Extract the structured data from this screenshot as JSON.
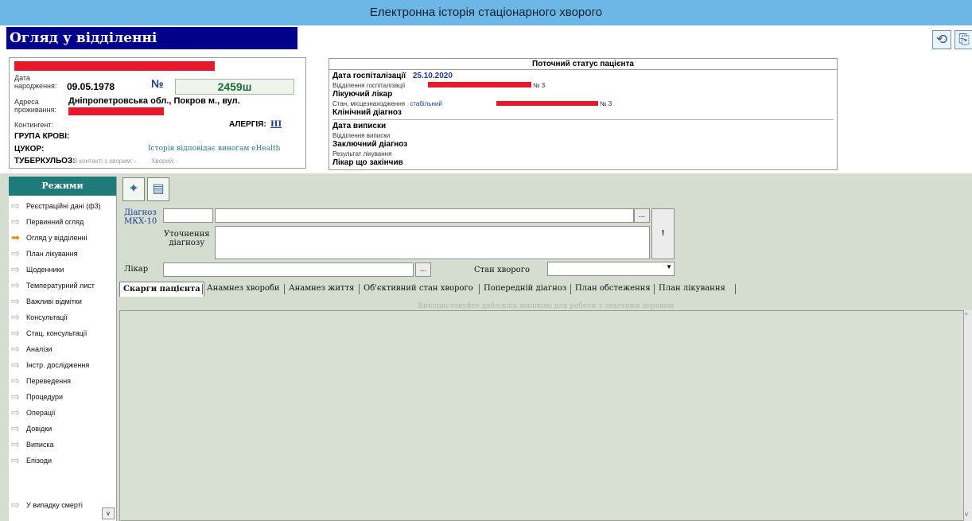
{
  "window": {
    "title": "Електронна історія стаціонарного хворого"
  },
  "screen": {
    "title": "Огляд у відділенні"
  },
  "top_icons": [
    {
      "icon": "refresh-icon",
      "glyph": "⟲"
    },
    {
      "icon": "exit-icon",
      "glyph": "⎘"
    }
  ],
  "patient": {
    "birth_label": "Дата\nнародження:",
    "birth_date": "09.05.1978",
    "number_label": "№",
    "number": "2459ш",
    "address_label": "Адреса\nпроживання:",
    "address": "Дніпропетровська обл., Покров м., вул.",
    "contingent_label": "Контингент:",
    "allergy_label": "АЛЕРГІЯ:",
    "allergy_value": "НІ",
    "blood_group_label": "ГРУПА КРОВІ:",
    "sugar_label": "ЦУКОР:",
    "ehealth_link": "Історія відповідає виногам eHealth",
    "tb_label": "ТУБЕРКУЛЬОЗ:",
    "tb_contact": "В контакті з хворим: -",
    "tb_sick": "Хворий: -"
  },
  "status": {
    "title": "Поточний статус пацієнта",
    "hosp_date_label": "Дата госпіталізації",
    "hosp_date": "25.10.2020",
    "hosp_dept_label": "Відділення госпіталізації",
    "hosp_dept_tail": "№ 3",
    "doctor_label": "Лікуючий лікар",
    "condition_label": "Стан, місцезнаходження",
    "condition_value": "стабільний",
    "condition_tail": "№ 3",
    "clinical_dx_label": "Клінічний діагноз",
    "discharge_date_label": "Дата виписки",
    "discharge_dept_label": "Відділення виписки",
    "final_dx_label": "Заключний діагноз",
    "result_label": "Результат лікування",
    "finishing_doctor_label": "Лікар що закінчив"
  },
  "sidebar": {
    "title": "Режими",
    "items": [
      {
        "label": "Реєстраційні дані (ф3)",
        "active": false
      },
      {
        "label": "Первинний огляд",
        "active": false
      },
      {
        "label": "Огляд у відділенні",
        "active": true
      },
      {
        "label": "План лікування",
        "active": false
      },
      {
        "label": "Щоденники",
        "active": false
      },
      {
        "label": "Температурний лист",
        "active": false
      },
      {
        "label": "Важливі відмітки",
        "active": false
      },
      {
        "label": "Консультації",
        "active": false
      },
      {
        "label": "Стац. консультації",
        "active": false
      },
      {
        "label": "Аналізи",
        "active": false
      },
      {
        "label": "Інстр. дослідження",
        "active": false
      },
      {
        "label": "Переведення",
        "active": false
      },
      {
        "label": "Процедури",
        "active": false
      },
      {
        "label": "Операції",
        "active": false
      },
      {
        "label": "Довідки",
        "active": false
      },
      {
        "label": "Виписка",
        "active": false
      },
      {
        "label": "Епізоди",
        "active": false
      }
    ],
    "death_item": "У випадку смерті"
  },
  "toolbar": {
    "new_icon": "new-document-icon",
    "doc_icon": "document-icon"
  },
  "form": {
    "diagnosis_label": "Діагноз\nМКХ-10",
    "diagnosis_code": "",
    "diagnosis_text": "",
    "browse_label": "...",
    "clarify_label": "Уточнення\nдіагнозу",
    "clarify_text": "",
    "warn_label": "!",
    "doctor_label": "Лікар",
    "doctor_value": "",
    "doctor_browse": "...",
    "condition_label": "Стан хворого",
    "condition_value": "",
    "dropdown_glyph": "▼"
  },
  "tabs": [
    {
      "label": "Скарги пацієнта",
      "active": true
    },
    {
      "label": "Анамнез хвороби",
      "active": false
    },
    {
      "label": "Анамнез життя",
      "active": false
    },
    {
      "label": "Об'єктивний стан хворого",
      "active": false
    },
    {
      "label": "Попередній діагноз",
      "active": false
    },
    {
      "label": "План обстеження",
      "active": false
    },
    {
      "label": "План лікування",
      "active": false
    }
  ],
  "hint": "Використовуйте дабл-клік мишкою для роботи з лекічним деревом",
  "scroll": {
    "up": "^",
    "down": "v"
  }
}
